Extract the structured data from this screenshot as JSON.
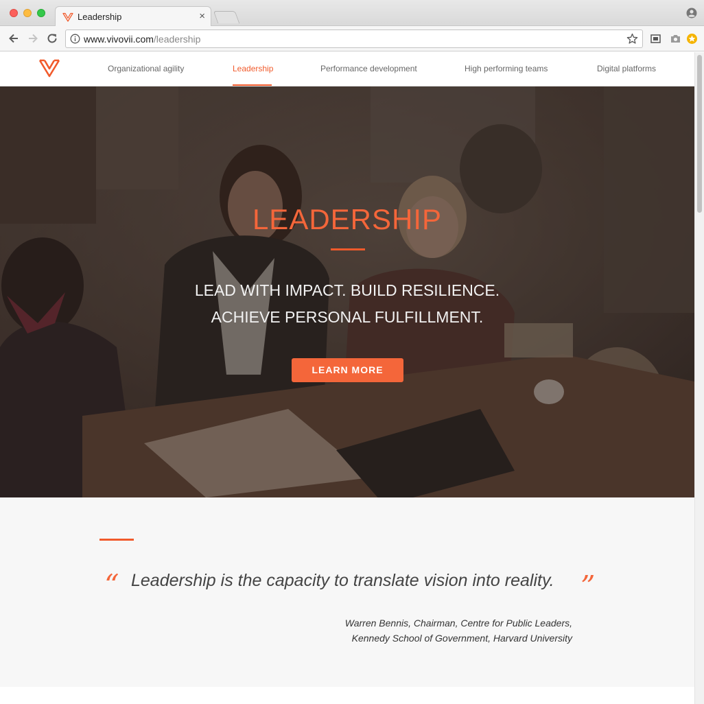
{
  "browser": {
    "tab_title": "Leadership",
    "tab_close": "×",
    "url_domain": "www.vivovii.com",
    "url_path": "/leadership"
  },
  "colors": {
    "accent": "#f4663a",
    "accent_dark": "#f15a2b",
    "quote_bg": "#f7f7f7"
  },
  "nav": {
    "items": [
      {
        "label": "Organizational agility",
        "active": false
      },
      {
        "label": "Leadership",
        "active": true
      },
      {
        "label": "Performance development",
        "active": false
      },
      {
        "label": "High performing teams",
        "active": false
      },
      {
        "label": "Digital platforms",
        "active": false
      }
    ]
  },
  "hero": {
    "title": "LEADERSHIP",
    "subtitle_line1": "LEAD WITH IMPACT. BUILD RESILIENCE.",
    "subtitle_line2": "ACHIEVE PERSONAL FULFILLMENT.",
    "cta_label": "LEARN MORE"
  },
  "quote": {
    "open_mark": "“",
    "text": "Leadership is the capacity to translate vision into reality.",
    "close_mark": "”",
    "attribution_line1": "Warren Bennis, Chairman, Centre for Public Leaders,",
    "attribution_line2": "Kennedy School of Government, Harvard University"
  },
  "icons": [
    "vivovii-logo-icon",
    "info-icon",
    "star-icon",
    "back-arrow-icon",
    "forward-arrow-icon",
    "reload-icon",
    "profile-icon",
    "cast-icon",
    "camera-icon",
    "extension-icon"
  ]
}
